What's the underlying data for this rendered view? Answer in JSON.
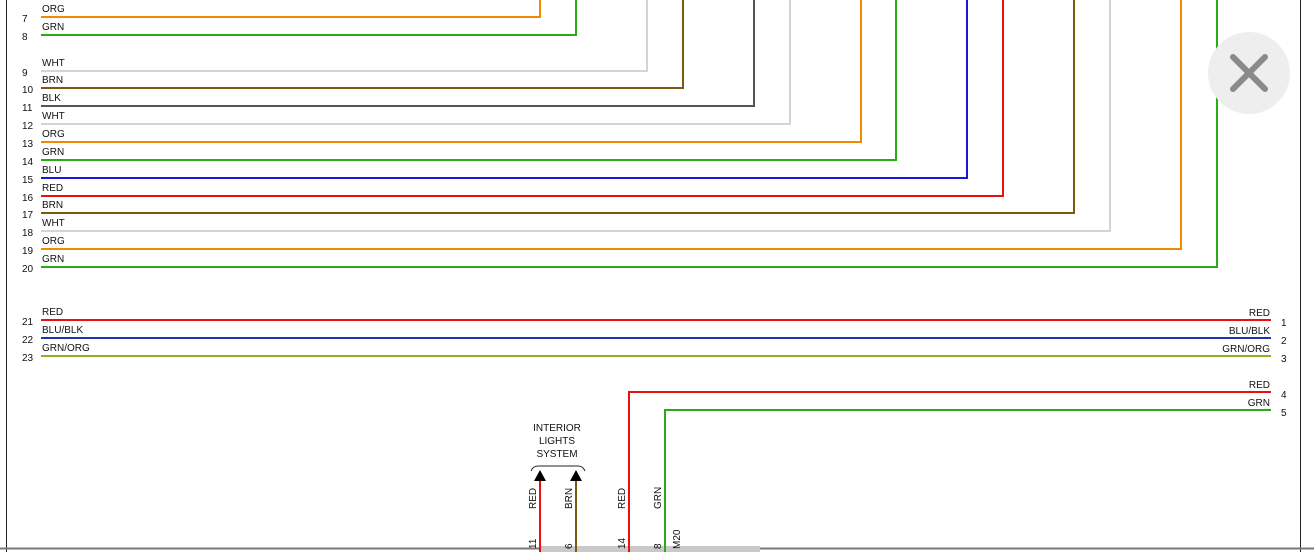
{
  "close_button": {
    "icon": "close-icon",
    "color": "#8a8a8a",
    "background": "#eeeeee"
  },
  "wire_colors": {
    "ORG": "#f08a00",
    "GRN": "#2aaa16",
    "WHT": "#d4d4d4",
    "BRN": "#7a5a10",
    "BLK": "#555555",
    "BLU": "#1818d8",
    "RED": "#e81010",
    "BLU/BLK": "#2030b0",
    "GRN/ORG": "#88b020"
  },
  "left_wires": [
    {
      "pin": "7",
      "color": "ORG"
    },
    {
      "pin": "8",
      "color": "GRN"
    },
    {
      "pin": "9",
      "color": "WHT"
    },
    {
      "pin": "10",
      "color": "BRN"
    },
    {
      "pin": "11",
      "color": "BLK"
    },
    {
      "pin": "12",
      "color": "WHT"
    },
    {
      "pin": "13",
      "color": "ORG"
    },
    {
      "pin": "14",
      "color": "GRN"
    },
    {
      "pin": "15",
      "color": "BLU"
    },
    {
      "pin": "16",
      "color": "RED"
    },
    {
      "pin": "17",
      "color": "BRN"
    },
    {
      "pin": "18",
      "color": "WHT"
    },
    {
      "pin": "19",
      "color": "ORG"
    },
    {
      "pin": "20",
      "color": "GRN"
    }
  ],
  "through_wires": [
    {
      "left_pin": "21",
      "right_pin": "1",
      "color": "RED"
    },
    {
      "left_pin": "22",
      "right_pin": "2",
      "color": "BLU/BLK"
    },
    {
      "left_pin": "23",
      "right_pin": "3",
      "color": "GRN/ORG"
    }
  ],
  "right_wires": [
    {
      "pin": "4",
      "color": "RED"
    },
    {
      "pin": "5",
      "color": "GRN"
    }
  ],
  "interior_lights": {
    "title_lines": [
      "INTERIOR",
      "LIGHTS",
      "SYSTEM"
    ],
    "wires": [
      {
        "color": "RED",
        "pin": "11"
      },
      {
        "color": "BRN",
        "pin": "6"
      }
    ]
  },
  "bottom_wires": [
    {
      "color": "RED",
      "pin": "14"
    },
    {
      "color": "GRN",
      "pin": "8"
    }
  ],
  "connector_label": "M20"
}
